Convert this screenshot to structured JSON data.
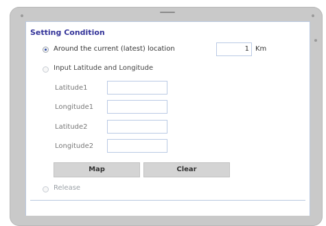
{
  "panel": {
    "title": "Setting Condition",
    "options": {
      "around": {
        "label": "Around the current (latest) location",
        "distance_value": "1",
        "unit": "Km",
        "checked": true
      },
      "latlon": {
        "label": "Input Latitude and Longitude",
        "checked": false
      },
      "release": {
        "label": "Release",
        "checked": false
      }
    },
    "fields": {
      "latitude1": {
        "label": "Latitude1",
        "value": ""
      },
      "longitude1": {
        "label": "Longitude1",
        "value": ""
      },
      "latitude2": {
        "label": "Latitude2",
        "value": ""
      },
      "longitude2": {
        "label": "Longitude2",
        "value": ""
      }
    },
    "buttons": {
      "map": "Map",
      "clear": "Clear"
    }
  }
}
